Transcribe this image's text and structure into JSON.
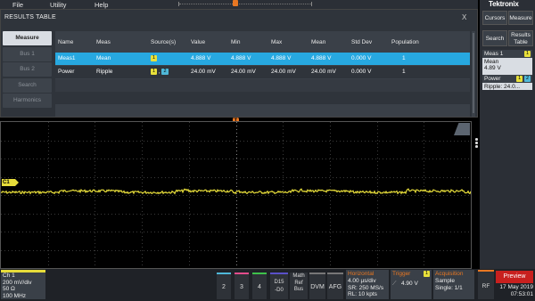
{
  "menu": {
    "file": "File",
    "utility": "Utility",
    "help": "Help"
  },
  "results": {
    "title": "RESULTS TABLE",
    "close": "X",
    "side_buttons": [
      "Measure",
      "Bus 1",
      "Bus 2",
      "Search",
      "Harmonics"
    ],
    "columns": [
      "Name",
      "Meas",
      "Source(s)",
      "Value",
      "Min",
      "Max",
      "Mean",
      "Std Dev",
      "Population"
    ],
    "rows": [
      {
        "name": "Meas1",
        "meas": "Mean",
        "src1": "1",
        "src2": "",
        "value": "4.888 V",
        "min": "4.888 V",
        "max": "4.888 V",
        "mean": "4.888 V",
        "std": "0.000 V",
        "pop": "1"
      },
      {
        "name": "Power",
        "meas": "Ripple",
        "src1": "1",
        "src2": "2",
        "value": "24.00 mV",
        "min": "24.00 mV",
        "max": "24.00 mV",
        "mean": "24.00 mV",
        "std": "0.000 V",
        "pop": "1"
      }
    ]
  },
  "waveform": {
    "channel_tag": "C1",
    "trace_color": "#e6dc3a",
    "trigger_glyph": "T"
  },
  "right_panel": {
    "brand": "Tektronix",
    "cursors": "Cursors",
    "measure": "Measure",
    "search": "Search",
    "results_table": "Results Table",
    "meas1_title": "Meas 1",
    "meas1_chip": "1",
    "meas1_label": "Mean",
    "meas1_value": "4.89 V",
    "power_title": "Power",
    "power_chip1": "1",
    "power_chip2": "2",
    "power_label": "Ripple:",
    "power_value": "24.0..."
  },
  "bottom": {
    "ch1_title": "Ch 1",
    "ch1_scale": "200 mV/div",
    "ch1_imp": "50 Ω",
    "ch1_bw": "100 MHz",
    "ch2": "2",
    "ch3": "3",
    "ch4": "4",
    "d15": "D15",
    "d0": "-D0",
    "math1": "Math",
    "math2": "Ref",
    "math3": "Bus",
    "dvm": "DVM",
    "afg": "AFG",
    "horizontal_title": "Horizontal",
    "h1": "4.00 µs/div",
    "h2": "SR: 250 MS/s",
    "h3": "RL: 10 kpts",
    "trigger_title": "Trigger",
    "trigger_chip": "1",
    "trigger_value": "4.90 V",
    "acq_title": "Acquisition",
    "acq1": "Sample",
    "acq2": "Single: 1/1",
    "rf": "RF",
    "preview": "Preview",
    "date": "17 May 2019",
    "time": "07:53:01"
  }
}
